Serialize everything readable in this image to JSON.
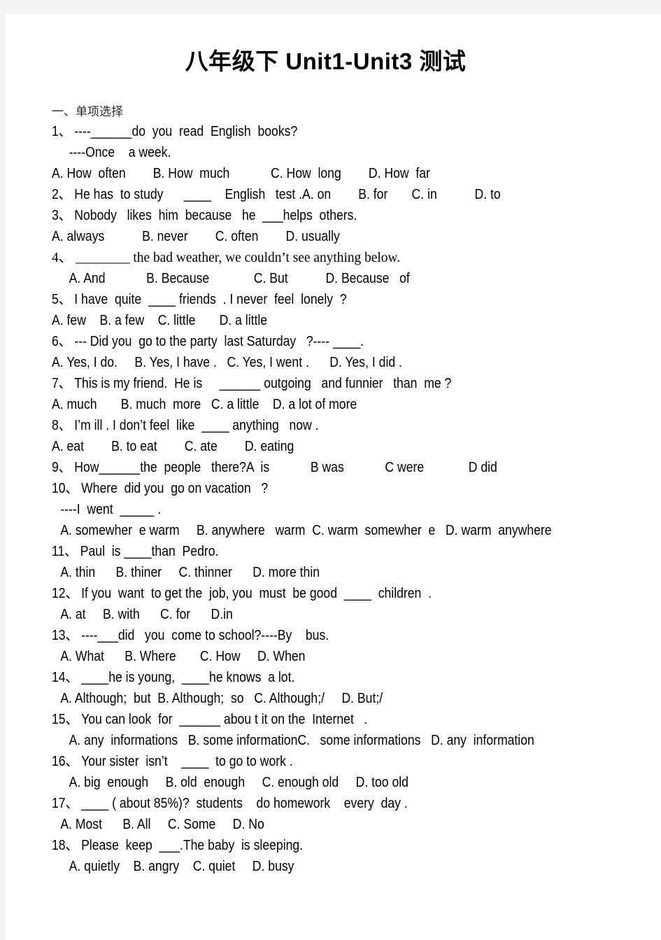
{
  "document": {
    "title": "八年级下 Unit1-Unit3 测试",
    "section_heading": "一、单项选择",
    "lines": [
      {
        "id": "q1-stem",
        "text": "1、 ----______do  you  read  English  books?",
        "indent": 0,
        "font": "sans"
      },
      {
        "id": "q1-answer",
        "text": "----Once    a week.",
        "indent": 2,
        "font": "sans"
      },
      {
        "id": "q1-options",
        "text": "A. How  often        B. How  much            C. How  long        D. How  far",
        "indent": 0,
        "font": "sans"
      },
      {
        "id": "q2",
        "text": "2、 He has  to study      ____    English   test .A. on        B. for       C. in           D. to",
        "indent": 0,
        "font": "sans"
      },
      {
        "id": "q3-stem",
        "text": "3、 Nobody   likes  him  because   he  ___helps  others.",
        "indent": 0,
        "font": "sans"
      },
      {
        "id": "q3-options",
        "text": "A. always           B. never        C. often        D. usually",
        "indent": 0,
        "font": "sans"
      },
      {
        "id": "q4-stem",
        "text": "4、 ________ the bad weather, we couldn’t see anything below.",
        "indent": 0,
        "font": "serif"
      },
      {
        "id": "q4-options",
        "text": "A. And            B. Because             C. But           D. Because   of",
        "indent": 2,
        "font": "sans"
      },
      {
        "id": "q5-stem",
        "text": "5、 I have  quite  ____ friends  . I never  feel  lonely  ?",
        "indent": 0,
        "font": "sans"
      },
      {
        "id": "q5-options",
        "text": "A. few    B. a few    C. little       D. a little",
        "indent": 0,
        "font": "sans"
      },
      {
        "id": "q6-stem",
        "text": "6、 --- Did you  go to the party  last Saturday   ?---- ____.",
        "indent": 0,
        "font": "sans"
      },
      {
        "id": "q6-options",
        "text": "A. Yes, I do.     B. Yes, I have .   C. Yes, I went .      D. Yes, I did .",
        "indent": 0,
        "font": "sans"
      },
      {
        "id": "q7-stem",
        "text": "7、 This is my friend.  He is     ______ outgoing   and funnier   than  me ?",
        "indent": 0,
        "font": "sans"
      },
      {
        "id": "q7-options",
        "text": "A. much       B. much  more   C. a little    D. a lot of more",
        "indent": 0,
        "font": "sans"
      },
      {
        "id": "q8-stem",
        "text": "8、 I’m ill . I don’t feel  like  ____ anything   now .",
        "indent": 0,
        "font": "sans"
      },
      {
        "id": "q8-options",
        "text": "A. eat        B. to eat        C. ate        D. eating",
        "indent": 0,
        "font": "sans"
      },
      {
        "id": "q9",
        "text": "9、 How______the  people   there?A  is            B was            C were             D did",
        "indent": 0,
        "font": "sans"
      },
      {
        "id": "q10-stem",
        "text": "10、 Where  did you  go on vacation   ?",
        "indent": 0,
        "font": "sans"
      },
      {
        "id": "q10-answer",
        "text": "----I  went  _____ .",
        "indent": 1,
        "font": "sans"
      },
      {
        "id": "q10-options",
        "text": "A. somewher  e warm     B. anywhere   warm  C. warm  somewher  e   D. warm  anywhere",
        "indent": 1,
        "font": "sans"
      },
      {
        "id": "q11-stem",
        "text": "11、 Paul  is ____than  Pedro.",
        "indent": 0,
        "font": "sans"
      },
      {
        "id": "q11-options",
        "text": "A. thin      B. thiner     C. thinner      D. more thin",
        "indent": 1,
        "font": "sans"
      },
      {
        "id": "q12-stem",
        "text": "12、 If you  want  to get the  job, you  must  be good  ____  children  .",
        "indent": 0,
        "font": "sans"
      },
      {
        "id": "q12-options",
        "text": "A. at     B. with      C. for      D.in",
        "indent": 1,
        "font": "sans"
      },
      {
        "id": "q13-stem",
        "text": "13、 ----___did   you  come to school?----By    bus.",
        "indent": 0,
        "font": "sans"
      },
      {
        "id": "q13-options",
        "text": "A. What      B. Where       C. How     D. When",
        "indent": 1,
        "font": "sans"
      },
      {
        "id": "q14-stem",
        "text": "14、 ____he is young,  ____he knows  a lot.",
        "indent": 0,
        "font": "sans"
      },
      {
        "id": "q14-options",
        "text": "A. Although;  but  B. Although;  so   C. Although;/     D. But;/",
        "indent": 1,
        "font": "sans"
      },
      {
        "id": "q15-stem",
        "text": "15、 You can look  for  ______ abou t it on the  Internet   .",
        "indent": 0,
        "font": "sans"
      },
      {
        "id": "q15-options",
        "text": "A. any  informations   B. some informationC.   some informations   D. any  information",
        "indent": 2,
        "font": "sans"
      },
      {
        "id": "q16-stem",
        "text": "16、 Your sister  isn’t    ____  to go to work .",
        "indent": 0,
        "font": "sans"
      },
      {
        "id": "q16-options",
        "text": "A. big  enough     B. old  enough     C. enough old     D. too old",
        "indent": 2,
        "font": "sans"
      },
      {
        "id": "q17-stem",
        "text": "17、 ____ ( about 85%)?  students    do homework    every  day .",
        "indent": 0,
        "font": "sans"
      },
      {
        "id": "q17-options",
        "text": "A. Most      B. All     C. Some     D. No",
        "indent": 1,
        "font": "sans"
      },
      {
        "id": "q18-stem",
        "text": "18、 Please  keep  ___.The baby  is sleeping.",
        "indent": 0,
        "font": "sans"
      },
      {
        "id": "q18-options",
        "text": "A. quietly    B. angry    C. quiet     D. busy",
        "indent": 2,
        "font": "sans"
      }
    ]
  },
  "colors": {
    "page_background": "#ffffff",
    "canvas_background": "#f4f4f4",
    "text": "#000000",
    "section_heading_text": "#2b2b2b"
  }
}
